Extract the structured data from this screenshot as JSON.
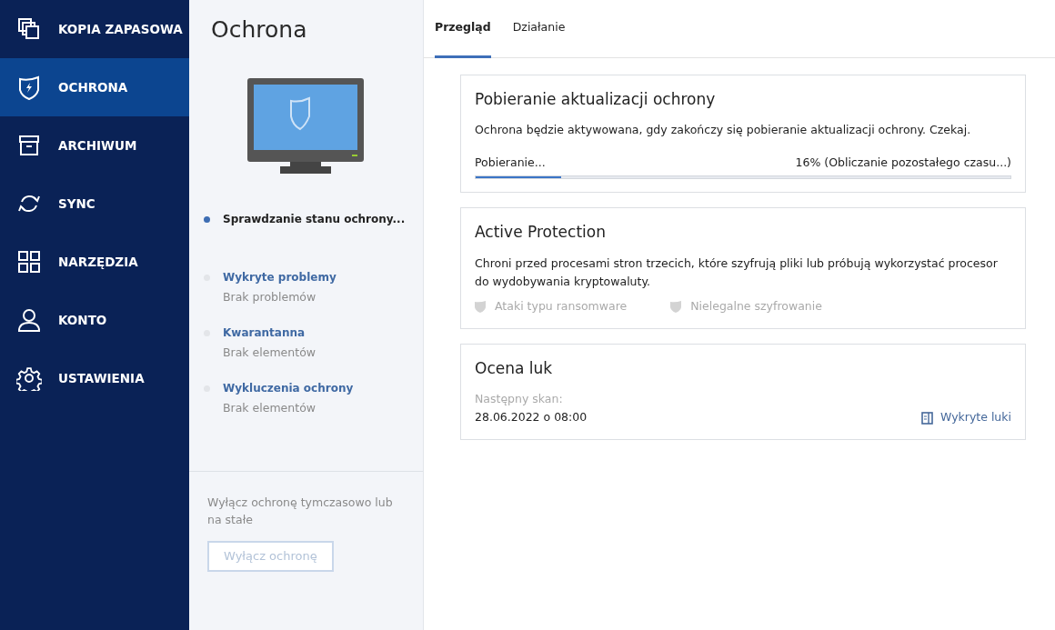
{
  "sidebar": {
    "items": [
      {
        "label": "KOPIA ZAPASOWA",
        "selected": false
      },
      {
        "label": "OCHRONA",
        "selected": true
      },
      {
        "label": "ARCHIWUM",
        "selected": false
      },
      {
        "label": "SYNC",
        "selected": false
      },
      {
        "label": "NARZĘDZIA",
        "selected": false
      },
      {
        "label": "KONTO",
        "selected": false
      },
      {
        "label": "USTAWIENIA",
        "selected": false
      }
    ]
  },
  "panel": {
    "title": "Ochrona",
    "status_items": [
      {
        "title": "Sprawdzanie stanu ochrony...",
        "active": true
      },
      {
        "title": "Wykryte problemy",
        "subtitle": "Brak problemów",
        "active": false
      },
      {
        "title": "Kwarantanna",
        "subtitle": "Brak elementów",
        "active": false
      },
      {
        "title": "Wykluczenia ochrony",
        "subtitle": "Brak elementów",
        "active": false
      }
    ],
    "footer_text": "Wyłącz ochronę tymczasowo lub na stałe",
    "button": {
      "label": "Wyłącz ochronę",
      "disabled": true
    }
  },
  "tabs": [
    {
      "label": "Przegląd",
      "selected": true
    },
    {
      "label": "Działanie",
      "selected": false
    }
  ],
  "cards": [
    {
      "kind": "progress",
      "title": "Pobieranie aktualizacji ochrony",
      "text": "Ochrona będzie aktywowana, gdy zakończy się pobieranie aktualizacji ochrony. Czekaj.",
      "progress_label": "Pobieranie...",
      "progress_reading": "16% (Obliczanie pozostałego czasu...)",
      "level": 0.16
    },
    {
      "kind": "features",
      "title": "Active Protection",
      "text": "Chroni przed procesami stron trzecich, które szyfrują pliki lub próbują wykorzystać procesor do wydobywania kryptowaluty.",
      "features": [
        {
          "label": "Ataki typu ransomware",
          "enabled": false
        },
        {
          "label": "Nielegalne szyfrowanie",
          "enabled": false
        }
      ]
    },
    {
      "kind": "schedule",
      "title": "Ocena luk",
      "label": "Następny skan:",
      "value": "28.06.2022 o 08:00",
      "link": "Wykryte luki"
    }
  ]
}
